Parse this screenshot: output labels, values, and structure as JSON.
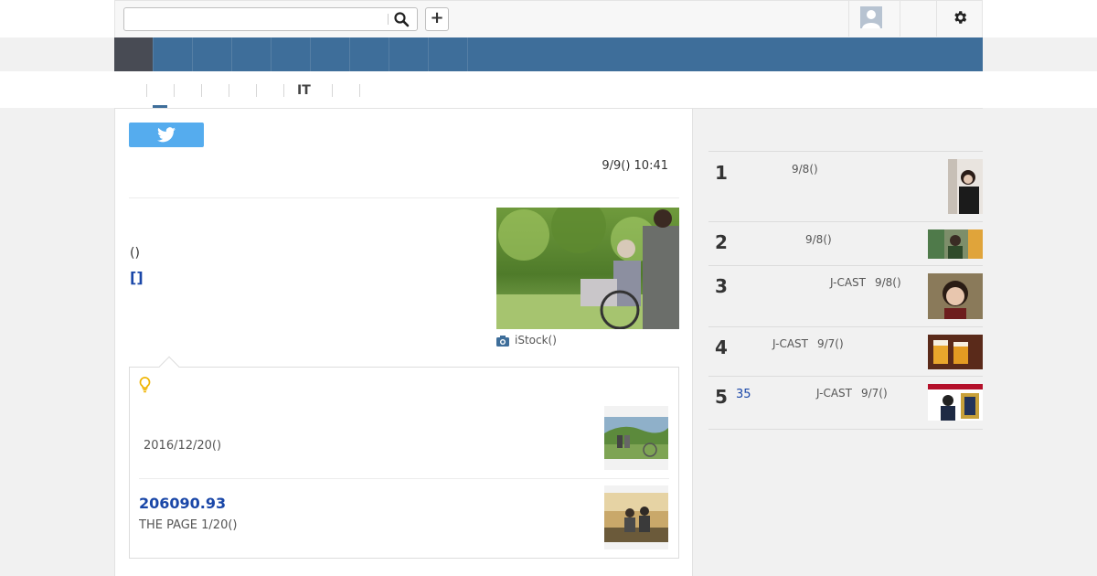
{
  "search": {
    "value": "",
    "placeholder": ""
  },
  "header": {
    "add_label": "+"
  },
  "subnav": {
    "items": [
      "",
      "",
      "",
      "",
      "",
      "IT",
      "",
      ""
    ]
  },
  "article": {
    "date": "9/9() 10:41",
    "paren_text": "()",
    "bracket_link": "[]",
    "photo_caption": "iStock()"
  },
  "related": {
    "items": [
      {
        "date": "2016/12/20()"
      },
      {
        "title": "206090.93",
        "source": "THE PAGE 1/20()"
      }
    ]
  },
  "ranking": {
    "items": [
      {
        "rank": "1",
        "count": "",
        "source": "",
        "date": "9/8()"
      },
      {
        "rank": "2",
        "count": "",
        "source": "",
        "date": "9/8()"
      },
      {
        "rank": "3",
        "count": "",
        "source": "J-CAST",
        "date": "9/8()"
      },
      {
        "rank": "4",
        "count": "",
        "source": "J-CAST",
        "date": "9/7()"
      },
      {
        "rank": "5",
        "count": "35",
        "source": "J-CAST",
        "date": "9/7()"
      }
    ]
  },
  "colors": {
    "nav": "#3e6e9a",
    "nav_active": "#484b54",
    "link": "#1a47a8",
    "twitter": "#55acee",
    "accent_bulb": "#f0b400"
  },
  "icons": [
    "search-icon",
    "plus-icon",
    "avatar-icon",
    "gear-icon",
    "twitter-icon",
    "camera-icon",
    "bulb-icon"
  ]
}
